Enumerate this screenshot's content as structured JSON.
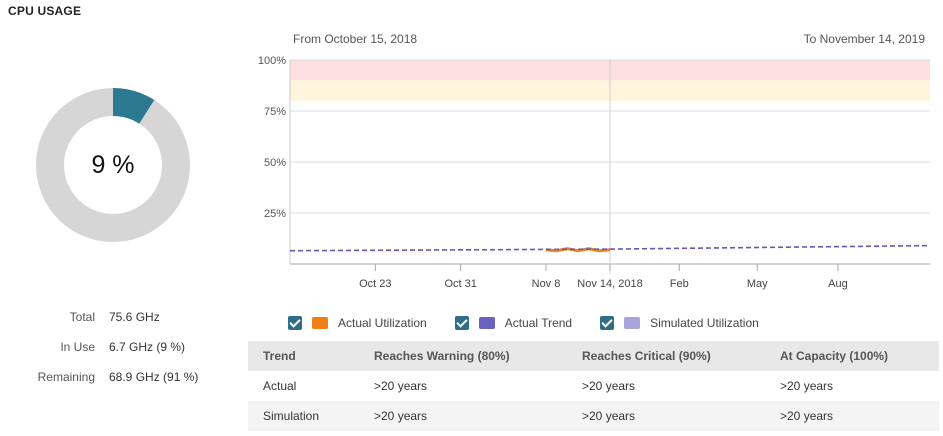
{
  "panel": {
    "title": "CPU USAGE"
  },
  "gauge": {
    "label": "9 %",
    "percent": 9,
    "fill_color": "#2b7a91",
    "track_color": "#d6d6d6"
  },
  "stats": [
    {
      "label": "Total",
      "value": "75.6 GHz"
    },
    {
      "label": "In Use",
      "value": "6.7 GHz (9 %)"
    },
    {
      "label": "Remaining",
      "value": "68.9 GHz (91 %)"
    }
  ],
  "range": {
    "from": "From October 15, 2018",
    "to": "To November 14, 2019"
  },
  "chart_data": {
    "type": "line",
    "y_ticks": [
      "100%",
      "75%",
      "50%",
      "25%"
    ],
    "y_tick_values": [
      100,
      75,
      50,
      25
    ],
    "ylim": [
      0,
      100
    ],
    "x_ticks": [
      "Oct 23",
      "Oct 31",
      "Nov 8",
      "Nov 14, 2018",
      "Feb",
      "May",
      "Aug"
    ],
    "x_tick_dates": [
      "2018-10-23",
      "2018-10-31",
      "2018-11-08",
      "2018-11-14",
      "2019-02-01",
      "2019-05-01",
      "2019-08-01"
    ],
    "bands": [
      {
        "name": "critical",
        "from": 90,
        "to": 100,
        "color": "#fde0df"
      },
      {
        "name": "warning",
        "from": 80,
        "to": 90,
        "color": "#fdf6dc"
      }
    ],
    "series": [
      {
        "name": "Actual Utilization",
        "style": "solid",
        "color": "#f07f1a",
        "x": [
          "2018-11-08",
          "2018-11-09",
          "2018-11-10",
          "2018-11-11",
          "2018-11-12",
          "2018-11-13",
          "2018-11-14"
        ],
        "y": [
          7,
          6.5,
          7.5,
          6.5,
          7.5,
          6.5,
          7
        ]
      },
      {
        "name": "Actual Trend",
        "style": "dashed",
        "color": "#5f5bb9",
        "x": [
          "2018-10-15",
          "2018-11-14",
          "2019-11-14"
        ],
        "y": [
          6.5,
          7.3,
          9
        ]
      }
    ]
  },
  "legend": [
    {
      "label": "Actual Utilization",
      "color": "#f07f1a"
    },
    {
      "label": "Actual Trend",
      "color": "#6a63be"
    },
    {
      "label": "Simulated Utilization",
      "color": "#a9a4dc"
    }
  ],
  "trend_table": {
    "headers": [
      "Trend",
      "Reaches Warning (80%)",
      "Reaches Critical (90%)",
      "At Capacity (100%)"
    ],
    "rows": [
      [
        "Actual",
        ">20 years",
        ">20 years",
        ">20 years"
      ],
      [
        "Simulation",
        ">20 years",
        ">20 years",
        ">20 years"
      ]
    ]
  }
}
